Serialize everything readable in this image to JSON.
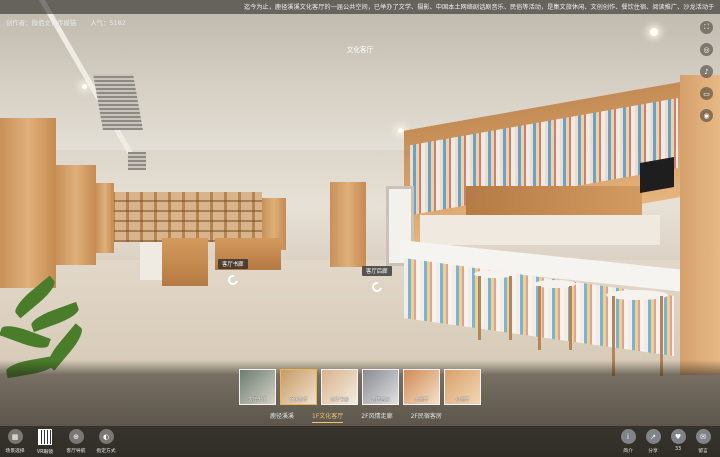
{
  "topbar": {
    "marquee": "迄今为止，鹿径溪溪文化客厅的一届公共空间，已举办了文学、摄影、中国本土网络剧话剧音乐、民俗等活动，是集文旅休闲、文创创作、餐饮住宿、阅读推广、沙龙活动于一体"
  },
  "info": {
    "author_label": "创作者：",
    "author_name": "微佰文化传媒猫",
    "views_label": "人气：",
    "views": "5182"
  },
  "scene_title": "文化客厅",
  "side_tools": [
    {
      "icon": "fullscreen-icon",
      "glyph": "⛶"
    },
    {
      "icon": "gyroscope-icon",
      "glyph": "◎"
    },
    {
      "icon": "microphone-icon",
      "glyph": "♪"
    },
    {
      "icon": "vr-glasses-icon",
      "glyph": "▭"
    },
    {
      "icon": "camera-icon",
      "glyph": "◉"
    }
  ],
  "hotspots": [
    {
      "label": "客厅书廊"
    },
    {
      "label": "客厅后廊"
    }
  ],
  "thumbnails": [
    {
      "label": "客厅大门",
      "color": "#6b7d72"
    },
    {
      "label": "文化客厅",
      "color": "#c79a66"
    },
    {
      "label": "客厅书廊",
      "color": "#d9b38b"
    },
    {
      "label": "客厅后廊",
      "color": "#8a8c93"
    },
    {
      "label": "大厨厅",
      "color": "#d08b55"
    },
    {
      "label": "小厨厅",
      "color": "#d9a06a"
    }
  ],
  "active_thumbnail": 1,
  "floor_tabs": [
    "鹿径溪溪",
    "1F文化客厅",
    "2F风情走廊",
    "2F民宿客房"
  ],
  "active_floor": 1,
  "bottom_left": [
    {
      "label": "场景选择",
      "icon": "scene-select-icon",
      "glyph": "▦"
    },
    {
      "label": "VR眼镜",
      "icon": "qr-code-icon",
      "glyph": ""
    },
    {
      "label": "客厅导航",
      "icon": "navigation-icon",
      "glyph": "⊕"
    },
    {
      "label": "指定方式",
      "icon": "view-mode-icon",
      "glyph": "◐"
    }
  ],
  "bottom_right": [
    {
      "label": "简介",
      "icon": "info-icon",
      "glyph": "i"
    },
    {
      "label": "分享",
      "icon": "share-icon",
      "glyph": "↗"
    },
    {
      "label": "33",
      "icon": "like-icon",
      "glyph": "♥"
    },
    {
      "label": "留言",
      "icon": "comment-icon",
      "glyph": "✉"
    }
  ]
}
